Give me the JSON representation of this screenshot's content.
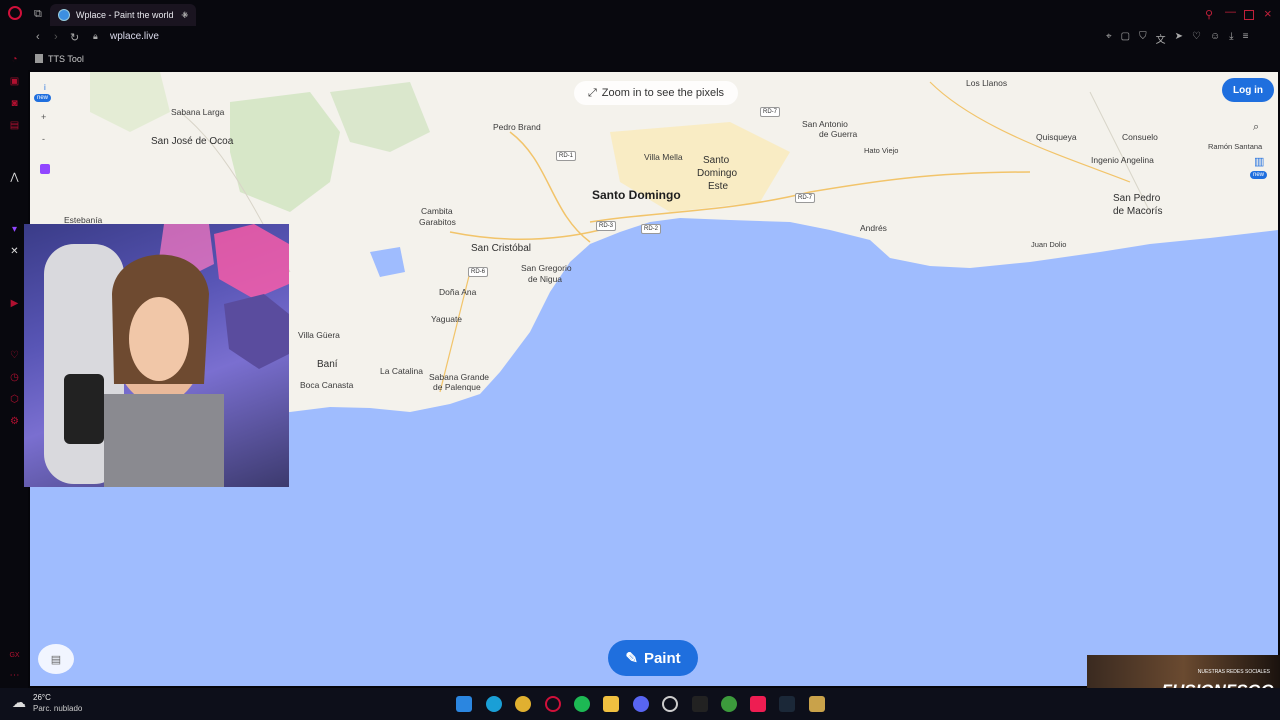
{
  "browser": {
    "tab_title": "Wplace - Paint the world",
    "new_tab_label": "+",
    "url": "wplace.live",
    "bookmark": "TTS Tool"
  },
  "map": {
    "zoom_hint": "Zoom in to see the pixels",
    "login_label": "Log in",
    "paint_label": "Paint",
    "new_badge": "new",
    "places": {
      "sabana_larga": "Sabana Larga",
      "san_jose_ocoa": "San José de Ocoa",
      "estebania": "Estebanía",
      "pedro_brand": "Pedro Brand",
      "villa_mella": "Villa Mella",
      "santo_domingo_este_1": "Santo",
      "santo_domingo_este_2": "Domingo",
      "santo_domingo_este_3": "Este",
      "santo_domingo": "Santo Domingo",
      "cambita_1": "Cambita",
      "cambita_2": "Garabitos",
      "san_cristobal": "San Cristóbal",
      "san_gregorio_1": "San Gregorio",
      "san_gregorio_2": "de Nigua",
      "dona_ana": "Doña Ana",
      "yaguate": "Yaguate",
      "villa_guera": "Villa Güera",
      "bani": "Baní",
      "la_catalina": "La Catalina",
      "sabana_grande_1": "Sabana Grande",
      "sabana_grande_2": "de Palenque",
      "boca_canasta": "Boca Canasta",
      "los_llanos": "Los Llanos",
      "san_antonio_1": "San Antonio",
      "san_antonio_2": "de Guerra",
      "hato_viejo": "Hato Viejo",
      "quisqueya": "Quisqueya",
      "consuelo": "Consuelo",
      "ramon_santana": "Ramón Santana",
      "ingenio_angelina": "Ingenio Angelina",
      "san_pedro_1": "San Pedro",
      "san_pedro_2": "de Macorís",
      "andres": "Andrés",
      "juan_dolio": "Juan Dolio"
    },
    "roads": {
      "rd1": "RD-1",
      "rd2": "RD-2",
      "rd3": "RD-3",
      "rd6": "RD-6",
      "rd7a": "RD-7",
      "rd7b": "RD-7"
    }
  },
  "overlay": {
    "promo_small": "NUESTRAS REDES SOCIALES",
    "promo_brand": "FUSIONFSGG"
  },
  "taskbar": {
    "temp": "26°C",
    "weather": "Parc. nublado"
  }
}
